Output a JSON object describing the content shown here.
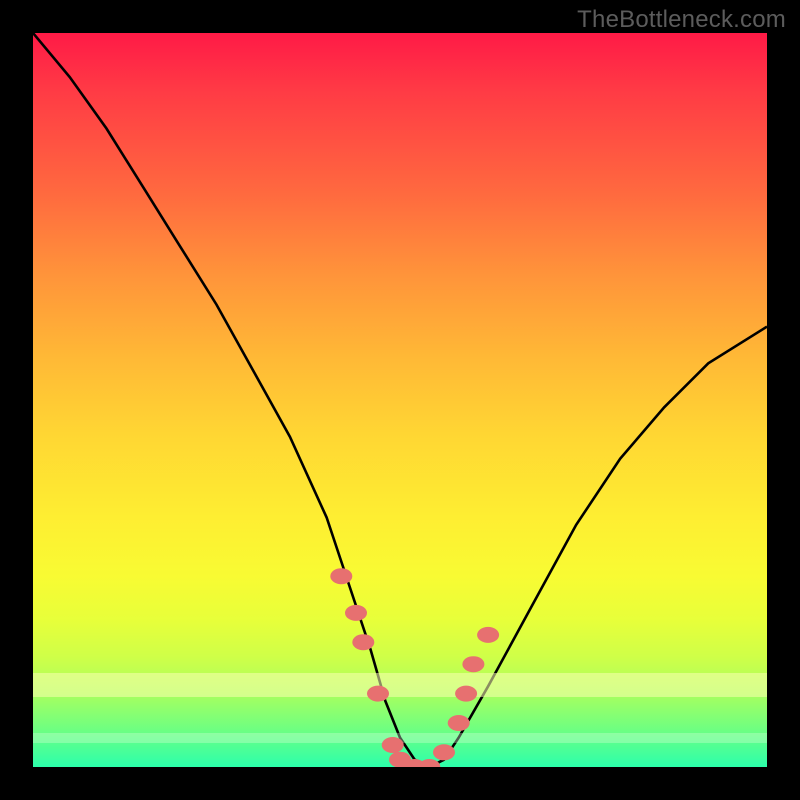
{
  "watermark": "TheBottleneck.com",
  "colors": {
    "frame": "#000000",
    "gradient_top": "#ff1a46",
    "gradient_bottom": "#2cffab",
    "curve": "#000000",
    "points": "#e77070"
  },
  "chart_data": {
    "type": "line",
    "title": "",
    "xlabel": "",
    "ylabel": "",
    "xlim": [
      0,
      100
    ],
    "ylim": [
      0,
      100
    ],
    "grid": false,
    "legend": false,
    "series": [
      {
        "name": "bottleneck-curve",
        "x": [
          0,
          5,
          10,
          15,
          20,
          25,
          30,
          35,
          40,
          43,
          46,
          48,
          50,
          52,
          54,
          56,
          58,
          62,
          68,
          74,
          80,
          86,
          92,
          100
        ],
        "y": [
          100,
          94,
          87,
          79,
          71,
          63,
          54,
          45,
          34,
          25,
          16,
          9,
          4,
          1,
          0,
          1,
          4,
          11,
          22,
          33,
          42,
          49,
          55,
          60
        ]
      }
    ],
    "highlight_points": {
      "name": "highlight-dots",
      "note": "pink blobs near the trough of the curve",
      "x": [
        42,
        44,
        45,
        47,
        49,
        50,
        52,
        54,
        56,
        58,
        59,
        60,
        62
      ],
      "y": [
        26,
        21,
        17,
        10,
        3,
        1,
        0,
        0,
        2,
        6,
        10,
        14,
        18
      ]
    }
  }
}
